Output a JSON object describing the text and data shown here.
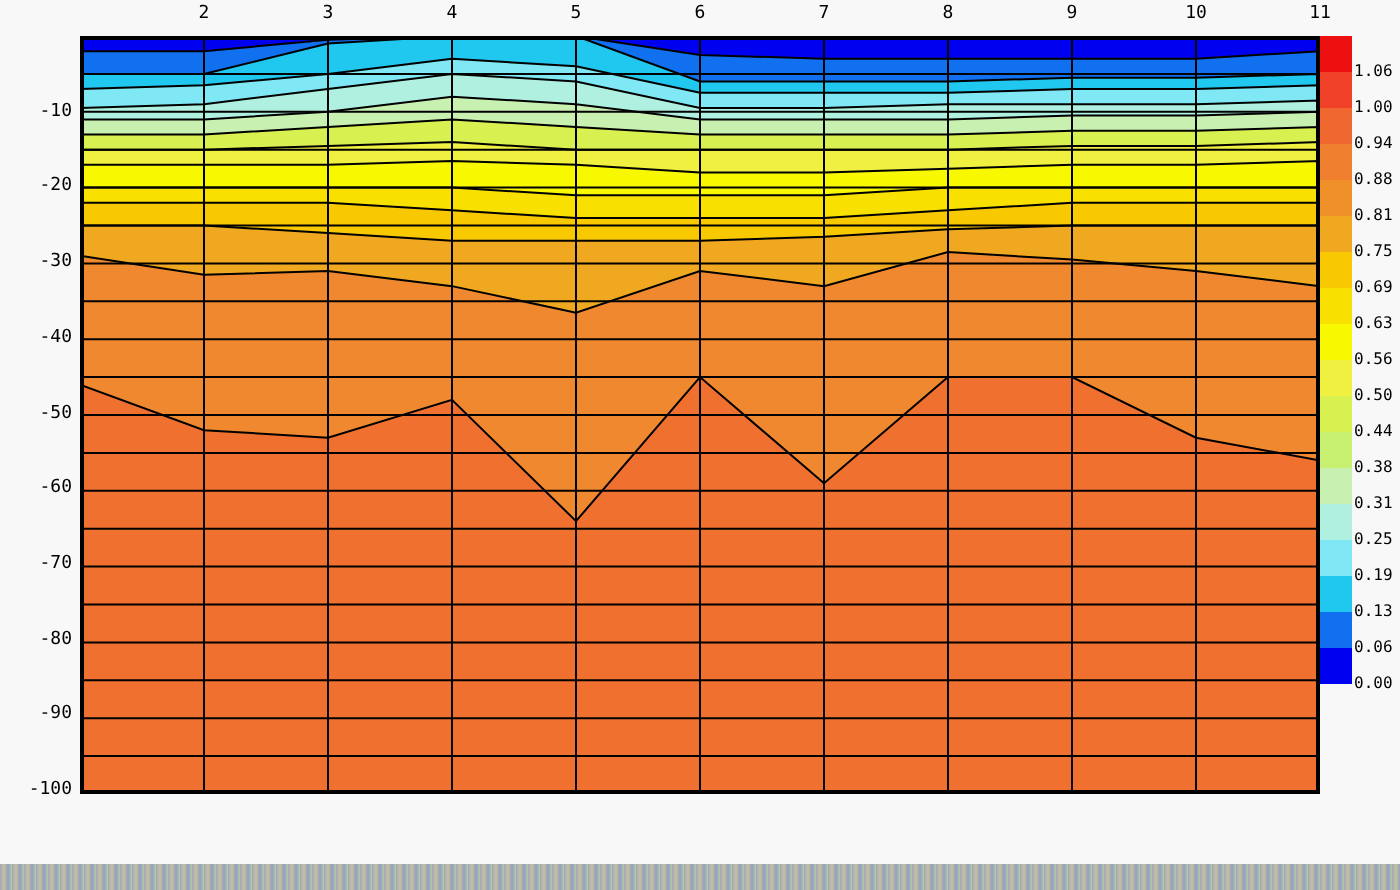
{
  "x_axis": {
    "labels": [
      "2",
      "3",
      "4",
      "5",
      "6",
      "7",
      "8",
      "9",
      "10",
      "11"
    ]
  },
  "y_axis": {
    "labels": [
      "-10",
      "-20",
      "-30",
      "-40",
      "-50",
      "-60",
      "-70",
      "-80",
      "-90",
      "-100"
    ]
  },
  "colorbar": {
    "segments": [
      {
        "color": "#ee1010"
      },
      {
        "color": "#f04028"
      },
      {
        "color": "#f06830"
      },
      {
        "color": "#f08030"
      },
      {
        "color": "#f09028"
      },
      {
        "color": "#f0a820"
      },
      {
        "color": "#f8c800"
      },
      {
        "color": "#f8e000"
      },
      {
        "color": "#f8f800"
      },
      {
        "color": "#f0f040"
      },
      {
        "color": "#d8f050"
      },
      {
        "color": "#c8f070"
      },
      {
        "color": "#c8f0b0"
      },
      {
        "color": "#b0f0e0"
      },
      {
        "color": "#80e8f4"
      },
      {
        "color": "#20c8f0"
      },
      {
        "color": "#1070f0"
      },
      {
        "color": "#0000f0"
      }
    ],
    "labels": [
      "1.06",
      "1.00",
      "0.94",
      "0.88",
      "0.81",
      "0.75",
      "0.69",
      "0.63",
      "0.56",
      "0.50",
      "0.44",
      "0.38",
      "0.31",
      "0.25",
      "0.19",
      "0.13",
      "0.06",
      "0.00"
    ]
  }
}
